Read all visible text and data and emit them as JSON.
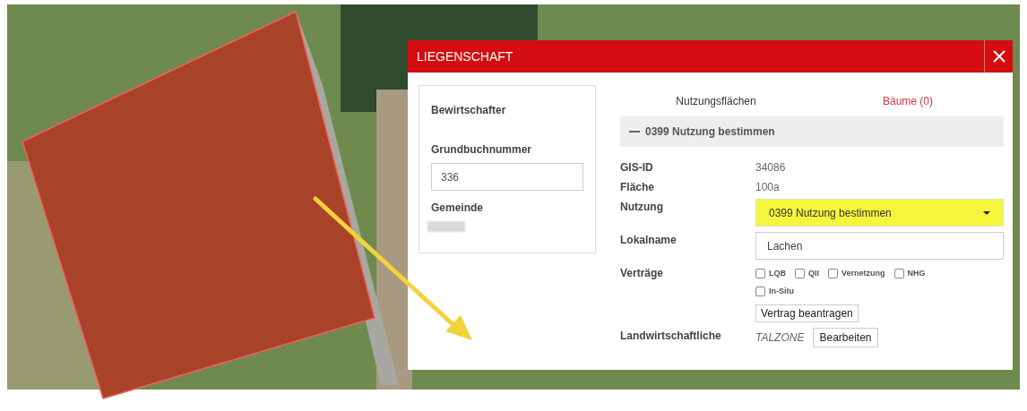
{
  "dialog": {
    "title": "LIEGENSCHAFT"
  },
  "left_card": {
    "heading": "Bewirtschafter",
    "fields": [
      {
        "kind": "input",
        "label": "Grundbuchnummer",
        "value": "336"
      },
      {
        "kind": "blurred",
        "label": "Gemeinde"
      }
    ]
  },
  "tabs": [
    {
      "label": "Nutzungsflächen",
      "selected": true
    },
    {
      "label": "Bäume (0)",
      "selected": false
    }
  ],
  "section": {
    "title": "0399 Nutzung bestimmen",
    "expanded": true
  },
  "rows": [
    {
      "kind": "text",
      "label": "GIS-ID",
      "value": "34086"
    },
    {
      "kind": "text",
      "label": "Fläche",
      "value": "100a"
    },
    {
      "kind": "select",
      "label": "Nutzung",
      "value": "0399 Nutzung bestimmen"
    },
    {
      "kind": "input",
      "label": "Lokalname",
      "value": "Lachen"
    },
    {
      "kind": "checks",
      "label": "Verträge",
      "options": [
        {
          "label": "LQB",
          "checked": false
        },
        {
          "label": "QII",
          "checked": false
        },
        {
          "label": "Vernetzung",
          "checked": false
        },
        {
          "label": "NHG",
          "checked": false
        },
        {
          "label": "In-Situ",
          "checked": false
        }
      ],
      "button": "Vertrag beantragen"
    },
    {
      "kind": "zone",
      "label": "Landwirtschaftliche",
      "value": "TALZONE",
      "button": "Bearbeiten"
    }
  ]
}
